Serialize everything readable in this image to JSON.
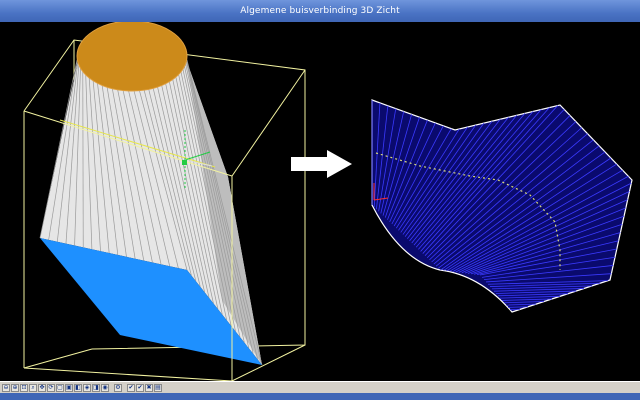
{
  "window": {
    "title": "Algemene buisverbinding 3D Zicht"
  },
  "colors": {
    "titlebar": "#4a73c4",
    "background": "#000000",
    "bounding_box": "#f2f2a0",
    "cone_body": "#e8e8e8",
    "top_face": "#cc8a1a",
    "bottom_face": "#1e90ff",
    "unfold_fill": "#0a0a6e",
    "unfold_lines": "#3a3aff",
    "arrow": "#ffffff"
  },
  "toolbar": {
    "buttons": [
      {
        "name": "zoom-out-icon",
        "glyph": "⊖"
      },
      {
        "name": "zoom-icon",
        "glyph": "⊕"
      },
      {
        "name": "zoom-window-icon",
        "glyph": "⊡"
      },
      {
        "name": "zoom-extents-icon",
        "glyph": "⌕"
      },
      {
        "name": "pan-icon",
        "glyph": "✥"
      },
      {
        "name": "rotate-icon",
        "glyph": "⟳"
      },
      {
        "name": "view-front-icon",
        "glyph": "▢"
      },
      {
        "name": "view-top-icon",
        "glyph": "▣"
      },
      {
        "name": "view-side-icon",
        "glyph": "◧"
      },
      {
        "name": "view-iso-icon",
        "glyph": "◈"
      },
      {
        "name": "view-back-icon",
        "glyph": "◨"
      },
      {
        "name": "render-icon",
        "glyph": "◉"
      },
      {
        "name": "settings-icon",
        "glyph": "⚙"
      },
      {
        "name": "check-icon",
        "glyph": "✔"
      },
      {
        "name": "check-alt-icon",
        "glyph": "✔"
      },
      {
        "name": "close-icon",
        "glyph": "✖"
      },
      {
        "name": "print-icon",
        "glyph": "▤"
      }
    ]
  }
}
